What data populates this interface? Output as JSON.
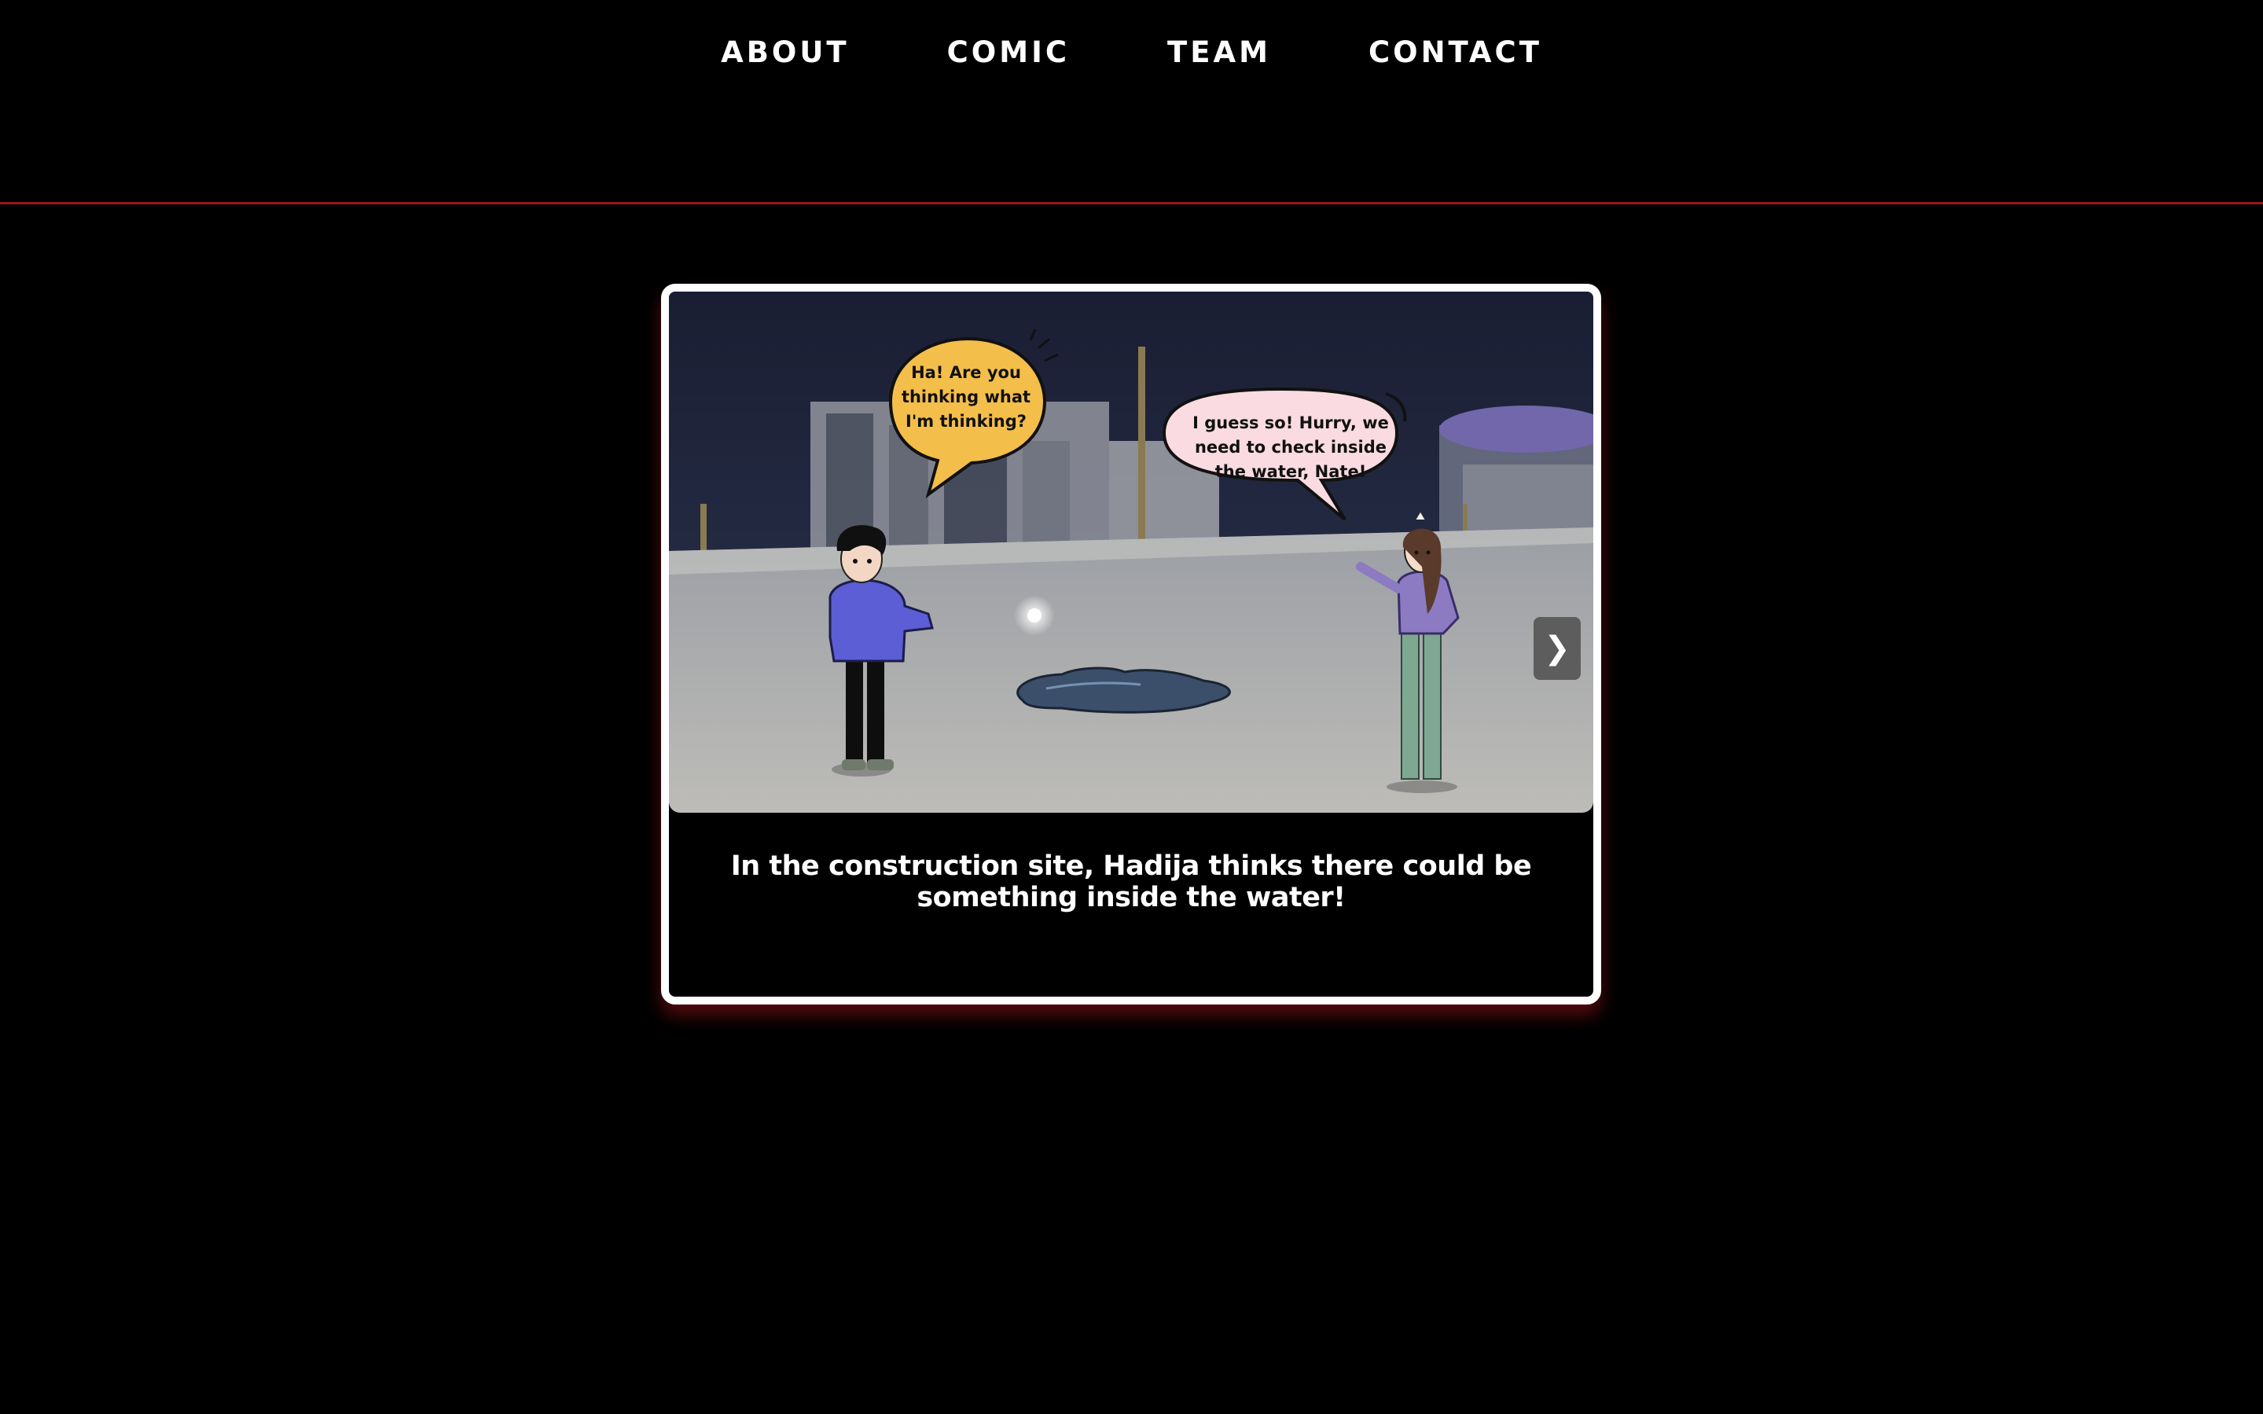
{
  "nav": {
    "items": [
      {
        "label": "ABOUT"
      },
      {
        "label": "COMIC"
      },
      {
        "label": "TEAM"
      },
      {
        "label": "CONTACT"
      }
    ]
  },
  "comic": {
    "speech_bubbles": [
      {
        "speaker": "Nate",
        "text": "Ha! Are you thinking what I'm thinking?"
      },
      {
        "speaker": "Hadija",
        "text": "I guess so! Hurry, we need to check inside the water, Nate!"
      }
    ],
    "caption": "In the construction site, Hadija thinks there could be something inside the water!",
    "next_label": "❯"
  },
  "colors": {
    "background": "#000000",
    "accent_rule": "#a3151b",
    "bubble_yellow": "#f4be4a",
    "bubble_pink": "#f9dbe1"
  }
}
